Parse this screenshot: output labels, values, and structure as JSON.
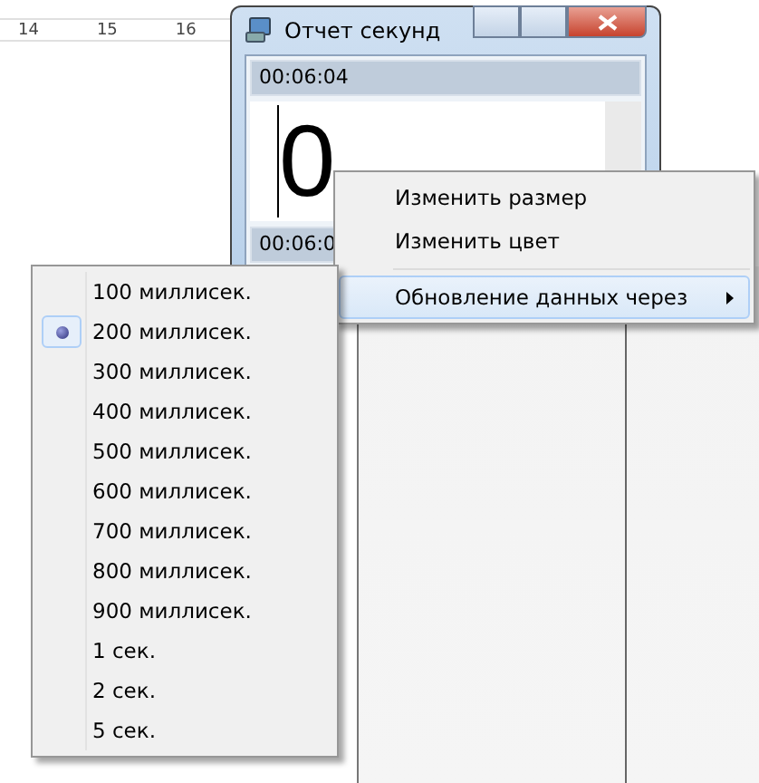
{
  "ruler": {
    "marks": [
      "14",
      "15",
      "16"
    ]
  },
  "window": {
    "title": "Отчет секунд",
    "elapsed_top": "00:06:04",
    "counter": "0",
    "elapsed_bottom": "00:06:0"
  },
  "context_menu": {
    "items": [
      {
        "kind": "item",
        "label": "Изменить размер",
        "selected": false
      },
      {
        "kind": "item",
        "label": "Изменить цвет",
        "selected": false
      },
      {
        "kind": "separator"
      },
      {
        "kind": "submenu",
        "label": "Обновление данных через",
        "selected": true
      }
    ]
  },
  "submenu": {
    "items": [
      {
        "label": "100 миллисек.",
        "selected": false
      },
      {
        "label": "200 миллисек.",
        "selected": true
      },
      {
        "label": "300 миллисек.",
        "selected": false
      },
      {
        "label": "400 миллисек.",
        "selected": false
      },
      {
        "label": "500 миллисек.",
        "selected": false
      },
      {
        "label": "600 миллисек.",
        "selected": false
      },
      {
        "label": "700 миллисек.",
        "selected": false
      },
      {
        "label": "800 миллисек.",
        "selected": false
      },
      {
        "label": "900 миллисек.",
        "selected": false
      },
      {
        "label": "1 сек.",
        "selected": false
      },
      {
        "label": "2 сек.",
        "selected": false
      },
      {
        "label": "5 сек.",
        "selected": false
      }
    ]
  }
}
